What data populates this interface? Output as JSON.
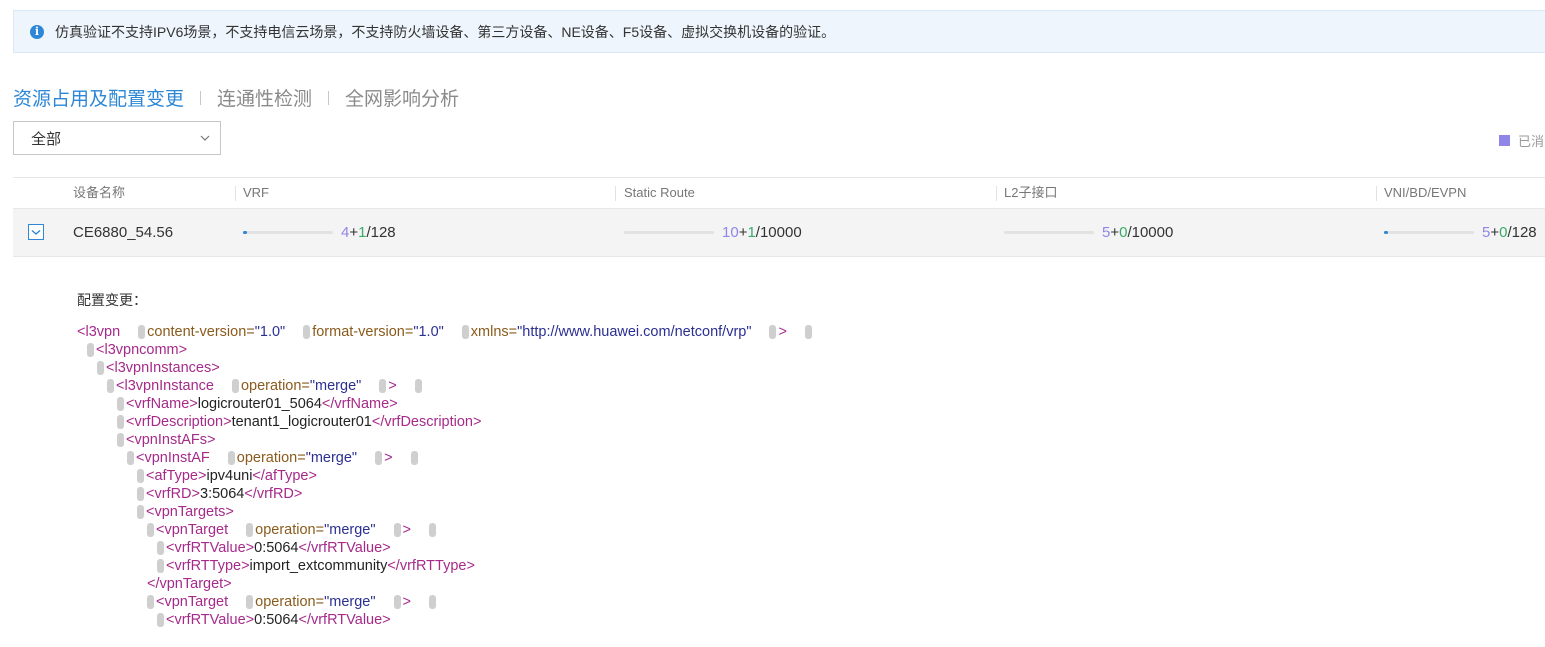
{
  "notice": {
    "text": "仿真验证不支持IPV6场景，不支持电信云场景，不支持防火墙设备、第三方设备、NE设备、F5设备、虚拟交换机设备的验证。"
  },
  "tabs": [
    {
      "label": "资源占用及配置变更",
      "active": true
    },
    {
      "label": "连通性检测",
      "active": false
    },
    {
      "label": "全网影响分析",
      "active": false
    }
  ],
  "filter": {
    "selected": "全部"
  },
  "legend": {
    "label": "已消",
    "color": "#8f86e8"
  },
  "table": {
    "columns": [
      "设备名称",
      "VRF",
      "Static Route",
      "L2子接口",
      "VNI/BD/EVPN"
    ],
    "rows": [
      {
        "checked": true,
        "device": "CE6880_54.56",
        "resources": [
          {
            "used": "4",
            "add": "1",
            "total": "/128",
            "fraction": 0.03
          },
          {
            "used": "10",
            "add": "1",
            "total": "/10000",
            "fraction": 0.001
          },
          {
            "used": "5",
            "add": "0",
            "total": "/10000",
            "fraction": 0.0005
          },
          {
            "used": "5",
            "add": "0",
            "total": "/128",
            "fraction": 0.04
          }
        ]
      }
    ]
  },
  "config": {
    "label": "配置变更：",
    "lines": [
      {
        "indent": 0,
        "segs": [
          [
            "tag",
            "<l3vpn"
          ],
          [
            "gap",
            ""
          ],
          [
            "grip",
            ""
          ],
          [
            "attr",
            "content-version="
          ],
          [
            "aval",
            "\"1.0\""
          ],
          [
            "gap",
            ""
          ],
          [
            "grip",
            ""
          ],
          [
            "attr",
            "format-version="
          ],
          [
            "aval",
            "\"1.0\""
          ],
          [
            "gap",
            ""
          ],
          [
            "grip",
            ""
          ],
          [
            "attr",
            "xmlns="
          ],
          [
            "aval",
            "\"http://www.huawei.com/netconf/vrp\""
          ],
          [
            "gap",
            ""
          ],
          [
            "grip",
            ""
          ],
          [
            "tag",
            ">"
          ],
          [
            "gap",
            ""
          ],
          [
            "grip",
            ""
          ]
        ]
      },
      {
        "indent": 1,
        "segs": [
          [
            "grip",
            ""
          ],
          [
            "tag",
            "<l3vpncomm>"
          ]
        ]
      },
      {
        "indent": 2,
        "segs": [
          [
            "grip",
            ""
          ],
          [
            "tag",
            "<l3vpnInstances>"
          ]
        ]
      },
      {
        "indent": 3,
        "segs": [
          [
            "grip",
            ""
          ],
          [
            "tag",
            "<l3vpnInstance"
          ],
          [
            "gap",
            ""
          ],
          [
            "grip",
            ""
          ],
          [
            "attr",
            "operation="
          ],
          [
            "aval",
            "\"merge\""
          ],
          [
            "gap",
            ""
          ],
          [
            "grip",
            ""
          ],
          [
            "tag",
            ">"
          ],
          [
            "gap",
            ""
          ],
          [
            "grip",
            ""
          ]
        ]
      },
      {
        "indent": 4,
        "segs": [
          [
            "grip",
            ""
          ],
          [
            "tag",
            "<vrfName>"
          ],
          [
            "txt",
            "logicrouter01_5064"
          ],
          [
            "tag",
            "</vrfName>"
          ]
        ]
      },
      {
        "indent": 4,
        "segs": [
          [
            "grip",
            ""
          ],
          [
            "tag",
            "<vrfDescription>"
          ],
          [
            "txt",
            "tenant1_logicrouter01"
          ],
          [
            "tag",
            "</vrfDescription>"
          ]
        ]
      },
      {
        "indent": 4,
        "segs": [
          [
            "grip",
            ""
          ],
          [
            "tag",
            "<vpnInstAFs>"
          ]
        ]
      },
      {
        "indent": 5,
        "segs": [
          [
            "grip",
            ""
          ],
          [
            "tag",
            "<vpnInstAF"
          ],
          [
            "gap",
            ""
          ],
          [
            "grip",
            ""
          ],
          [
            "attr",
            "operation="
          ],
          [
            "aval",
            "\"merge\""
          ],
          [
            "gap",
            ""
          ],
          [
            "grip",
            ""
          ],
          [
            "tag",
            ">"
          ],
          [
            "gap",
            ""
          ],
          [
            "grip",
            ""
          ]
        ]
      },
      {
        "indent": 6,
        "segs": [
          [
            "grip",
            ""
          ],
          [
            "tag",
            "<afType>"
          ],
          [
            "txt",
            "ipv4uni"
          ],
          [
            "tag",
            "</afType>"
          ]
        ]
      },
      {
        "indent": 6,
        "segs": [
          [
            "grip",
            ""
          ],
          [
            "tag",
            "<vrfRD>"
          ],
          [
            "txt",
            "3:5064"
          ],
          [
            "tag",
            "</vrfRD>"
          ]
        ]
      },
      {
        "indent": 6,
        "segs": [
          [
            "grip",
            ""
          ],
          [
            "tag",
            "<vpnTargets>"
          ]
        ]
      },
      {
        "indent": 7,
        "segs": [
          [
            "grip",
            ""
          ],
          [
            "tag",
            "<vpnTarget"
          ],
          [
            "gap",
            ""
          ],
          [
            "grip",
            ""
          ],
          [
            "attr",
            "operation="
          ],
          [
            "aval",
            "\"merge\""
          ],
          [
            "gap",
            ""
          ],
          [
            "grip",
            ""
          ],
          [
            "tag",
            ">"
          ],
          [
            "gap",
            ""
          ],
          [
            "grip",
            ""
          ]
        ]
      },
      {
        "indent": 8,
        "segs": [
          [
            "grip",
            ""
          ],
          [
            "tag",
            "<vrfRTValue>"
          ],
          [
            "txt",
            "0:5064"
          ],
          [
            "tag",
            "</vrfRTValue>"
          ]
        ]
      },
      {
        "indent": 8,
        "segs": [
          [
            "grip",
            ""
          ],
          [
            "tag",
            "<vrfRTType>"
          ],
          [
            "txt",
            "import_extcommunity"
          ],
          [
            "tag",
            "</vrfRTType>"
          ]
        ]
      },
      {
        "indent": 7,
        "segs": [
          [
            "tag",
            "</vpnTarget>"
          ]
        ]
      },
      {
        "indent": 7,
        "segs": [
          [
            "grip",
            ""
          ],
          [
            "tag",
            "<vpnTarget"
          ],
          [
            "gap",
            ""
          ],
          [
            "grip",
            ""
          ],
          [
            "attr",
            "operation="
          ],
          [
            "aval",
            "\"merge\""
          ],
          [
            "gap",
            ""
          ],
          [
            "grip",
            ""
          ],
          [
            "tag",
            ">"
          ],
          [
            "gap",
            ""
          ],
          [
            "grip",
            ""
          ]
        ]
      },
      {
        "indent": 8,
        "segs": [
          [
            "grip",
            ""
          ],
          [
            "tag",
            "<vrfRTValue>"
          ],
          [
            "txt",
            "0:5064"
          ],
          [
            "tag",
            "</vrfRTValue>"
          ]
        ]
      }
    ]
  }
}
